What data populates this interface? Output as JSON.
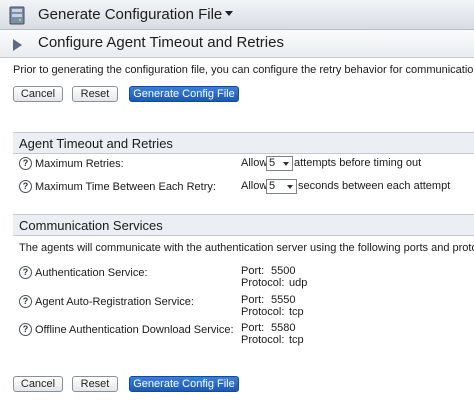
{
  "header": {
    "title": "Generate Configuration File",
    "icon": "server-icon"
  },
  "subheader": {
    "title": "Configure Agent Timeout and Retries"
  },
  "intro": {
    "text": "Prior to generating the configuration file, you can configure the retry behavior for communication betw"
  },
  "actions": {
    "cancel": "Cancel",
    "reset": "Reset",
    "generate": "Generate Config File"
  },
  "timeout_section": {
    "title": "Agent Timeout and Retries",
    "rows": [
      {
        "label": "Maximum Retries:",
        "prefix": "Allow",
        "value": "5",
        "suffix": "attempts before timing out"
      },
      {
        "label": "Maximum Time Between Each Retry:",
        "prefix": "Allow",
        "value": "5",
        "suffix": "seconds between each attempt"
      }
    ]
  },
  "comm_section": {
    "title": "Communication Services",
    "description": "The agents will communicate with the authentication server using the following ports and protocols. T",
    "services": [
      {
        "label": "Authentication Service:",
        "port_label": "Port:",
        "port": "5500",
        "protocol_label": "Protocol:",
        "protocol": "udp"
      },
      {
        "label": "Agent Auto-Registration Service:",
        "port_label": "Port:",
        "port": "5550",
        "protocol_label": "Protocol:",
        "protocol": "tcp"
      },
      {
        "label": "Offline Authentication Download Service:",
        "port_label": "Port:",
        "port": "5580",
        "protocol_label": "Protocol:",
        "protocol": "tcp"
      }
    ]
  },
  "colors": {
    "primary_button": "#1a59b8",
    "section_bg": "#ebeef2"
  }
}
